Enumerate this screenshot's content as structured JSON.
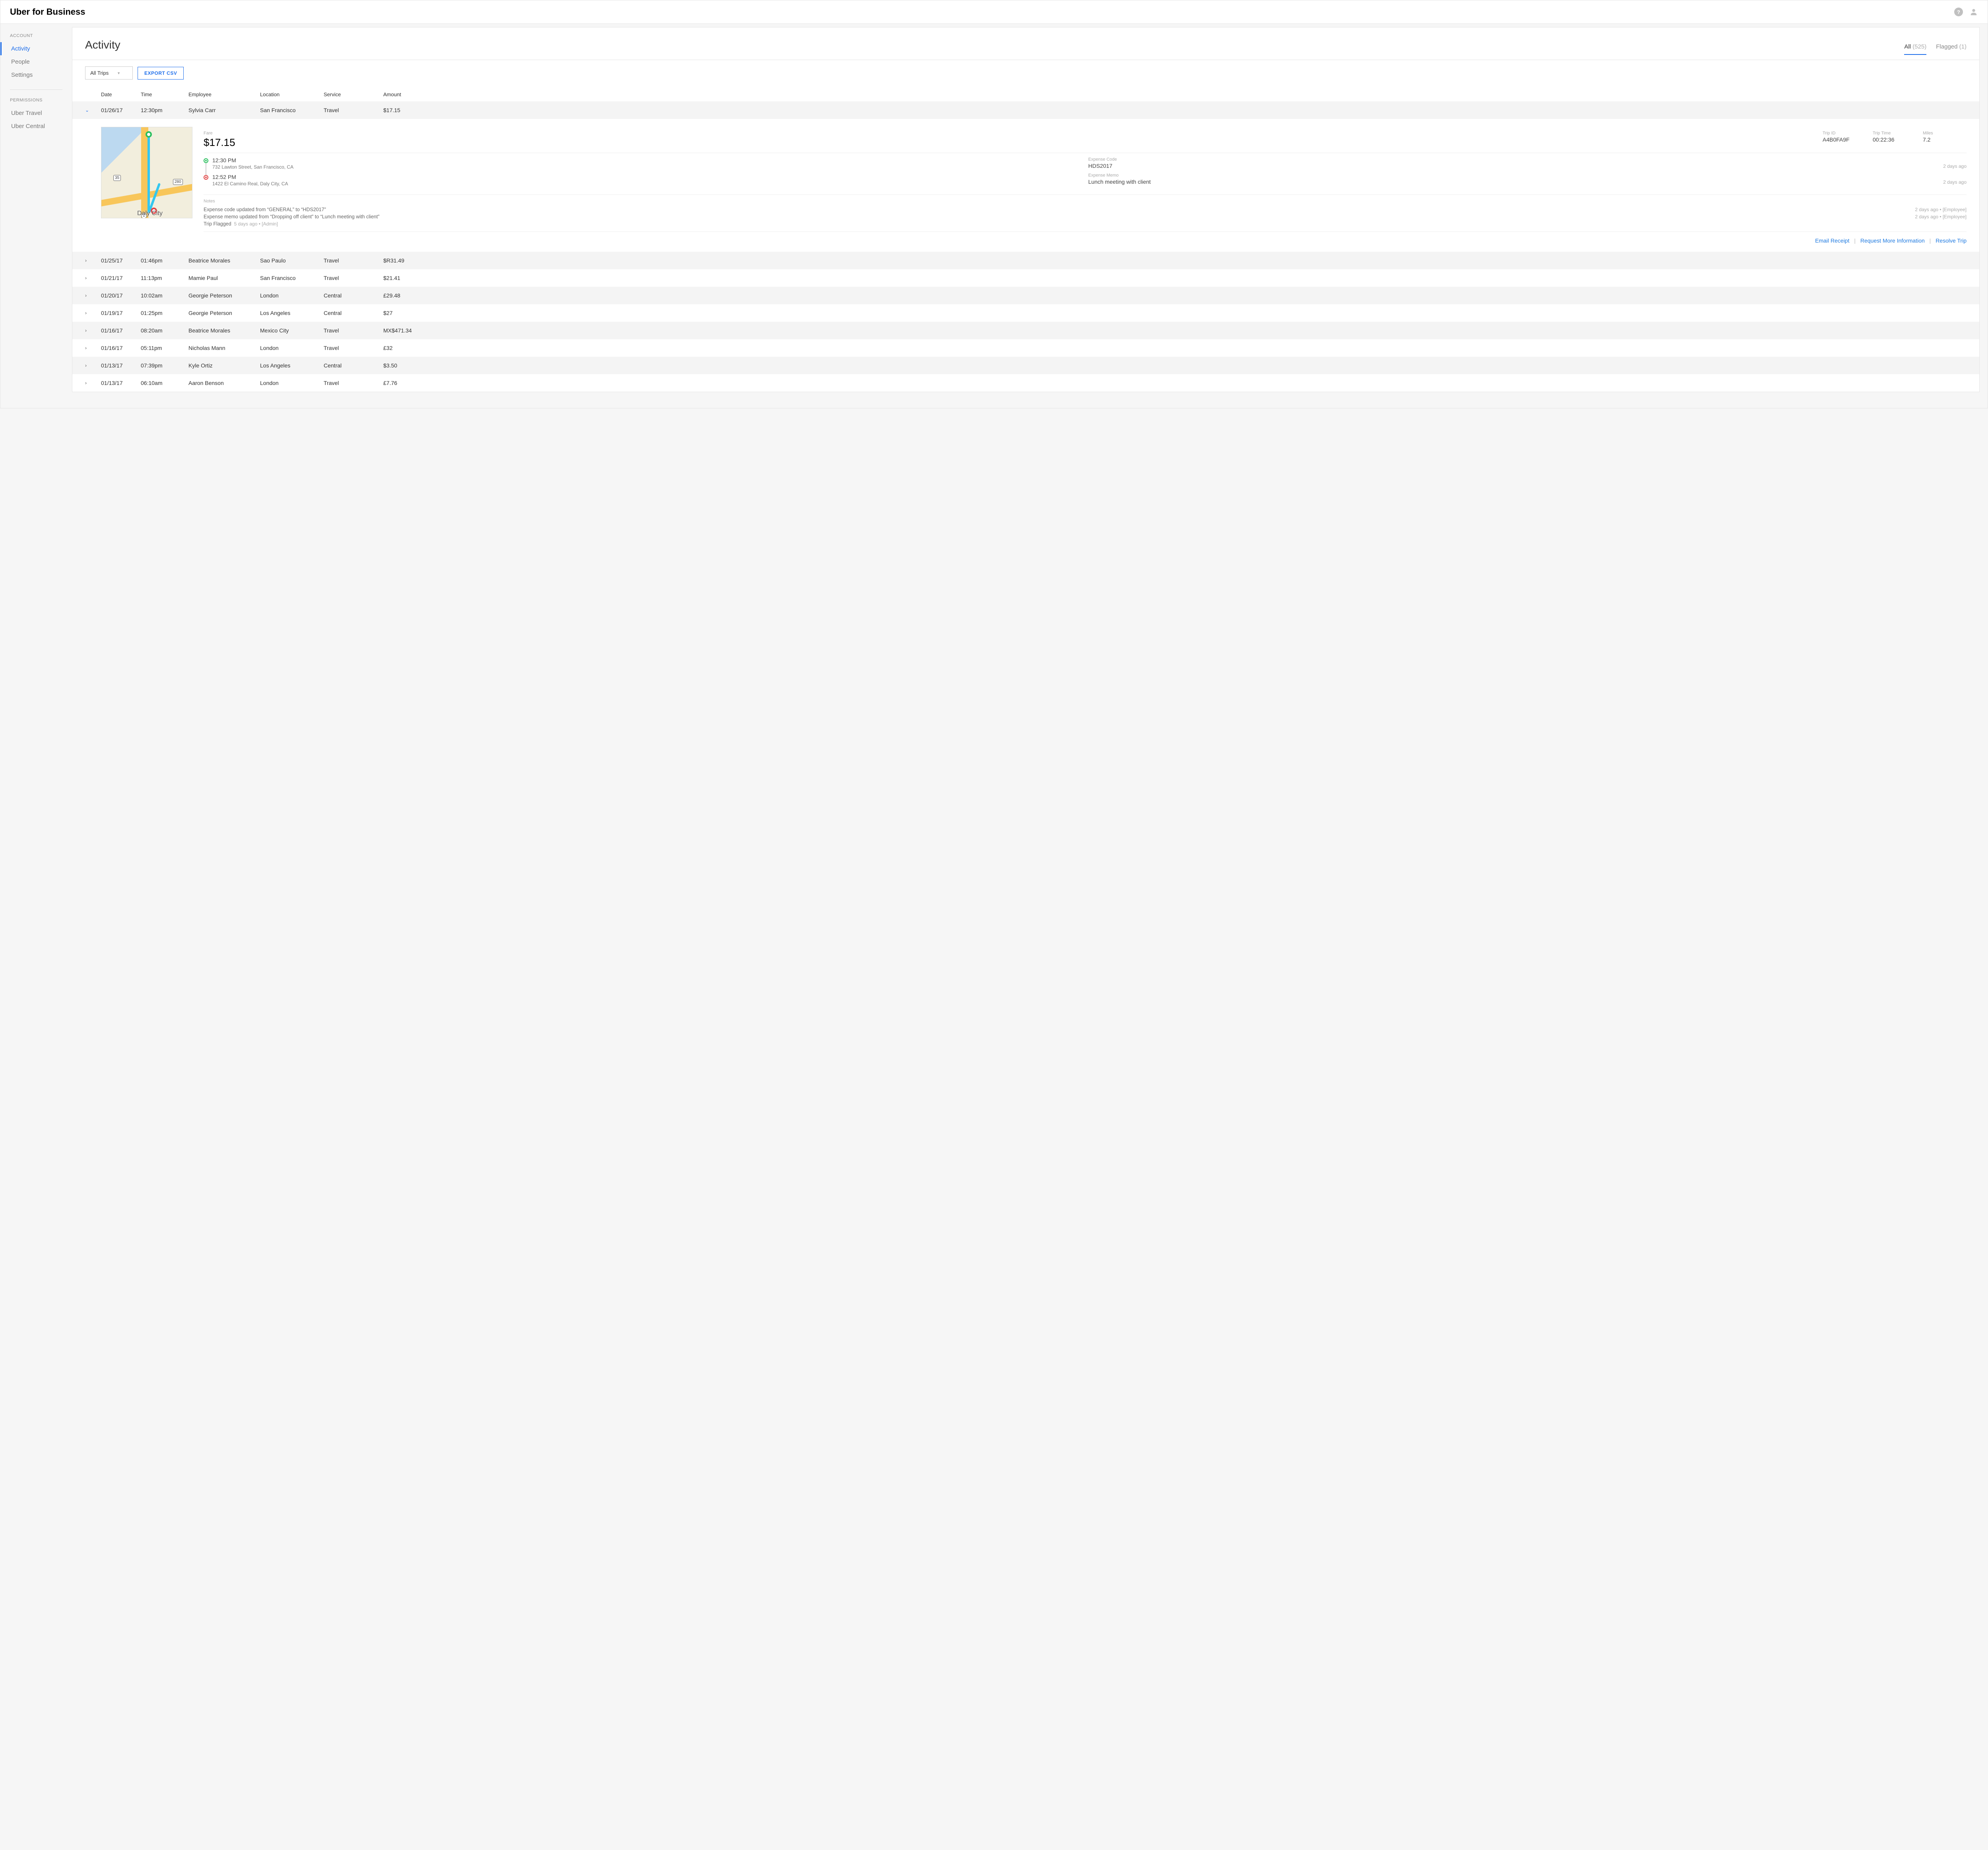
{
  "brand": "Uber for Business",
  "sidebar": {
    "section_account": "ACCOUNT",
    "section_permissions": "PERMISSIONS",
    "items_account": [
      {
        "label": "Activity",
        "active": true
      },
      {
        "label": "People"
      },
      {
        "label": "Settings"
      }
    ],
    "items_permissions": [
      {
        "label": "Uber Travel"
      },
      {
        "label": "Uber Central"
      }
    ]
  },
  "page": {
    "title": "Activity",
    "tabs": [
      {
        "label": "All",
        "count": "(525)",
        "active": true
      },
      {
        "label": "Flagged",
        "count": "(1)"
      }
    ],
    "filter_select": "All Trips",
    "export_label": "EXPORT CSV"
  },
  "columns": {
    "date": "Date",
    "time": "Time",
    "employee": "Employee",
    "location": "Location",
    "service": "Service",
    "amount": "Amount"
  },
  "expanded": {
    "date": "01/26/17",
    "time": "12:30pm",
    "employee": "Sylvia Carr",
    "location": "San Francisco",
    "service": "Travel",
    "amount": "$17.15",
    "map_city": "Daly City",
    "fare_label": "Fare",
    "fare": "$17.15",
    "trip_id_label": "Trip ID",
    "trip_id": "A4B0FA9F",
    "trip_time_label": "Trip Time",
    "trip_time": "00:22:36",
    "miles_label": "Miles",
    "miles": "7.2",
    "pickup_time": "12:30 PM",
    "pickup_addr": "732 Lawton Street, San Francisco, CA",
    "dropoff_time": "12:52 PM",
    "dropoff_addr": "1422 El Camino Real, Daly City, CA",
    "exp_code_label": "Expense Code",
    "exp_code": "HDS2017",
    "exp_code_ago": "2 days ago",
    "exp_memo_label": "Expense Memo",
    "exp_memo": "Lunch meeting with client",
    "exp_memo_ago": "2 days ago",
    "notes_label": "Notes",
    "notes": [
      {
        "text": "Expense code updated from “GENERAL” to “HDS2017”",
        "meta": "2 days ago • [Employee]"
      },
      {
        "text": "Expense memo updated from “Dropping off client” to “Lunch meeting with client”",
        "meta": "2 days ago • [Employee]"
      },
      {
        "text": "Trip Flagged",
        "meta": "5 days ago • [Admin]",
        "inline": true
      }
    ],
    "actions": {
      "email": "Email Receipt",
      "request": "Request More Information",
      "resolve": "Resolve Trip"
    }
  },
  "trips": [
    {
      "date": "01/25/17",
      "time": "01:46pm",
      "employee": "Beatrice Morales",
      "location": "Sao Paulo",
      "service": "Travel",
      "amount": "$R31.49"
    },
    {
      "date": "01/21/17",
      "time": "11:13pm",
      "employee": "Mamie Paul",
      "location": "San Francisco",
      "service": "Travel",
      "amount": "$21.41"
    },
    {
      "date": "01/20/17",
      "time": "10:02am",
      "employee": "Georgie Peterson",
      "location": "London",
      "service": "Central",
      "amount": "£29.48"
    },
    {
      "date": "01/19/17",
      "time": "01:25pm",
      "employee": "Georgie Peterson",
      "location": "Los Angeles",
      "service": "Central",
      "amount": "$27"
    },
    {
      "date": "01/16/17",
      "time": "08:20am",
      "employee": "Beatrice Morales",
      "location": "Mexico City",
      "service": "Travel",
      "amount": "MX$471.34"
    },
    {
      "date": "01/16/17",
      "time": "05:11pm",
      "employee": "Nicholas Mann",
      "location": "London",
      "service": "Travel",
      "amount": "£32"
    },
    {
      "date": "01/13/17",
      "time": "07:39pm",
      "employee": "Kyle Ortiz",
      "location": "Los Angeles",
      "service": "Central",
      "amount": "$3.50"
    },
    {
      "date": "01/13/17",
      "time": "06:10am",
      "employee": "Aaron Benson",
      "location": "London",
      "service": "Travel",
      "amount": "£7.76"
    }
  ]
}
